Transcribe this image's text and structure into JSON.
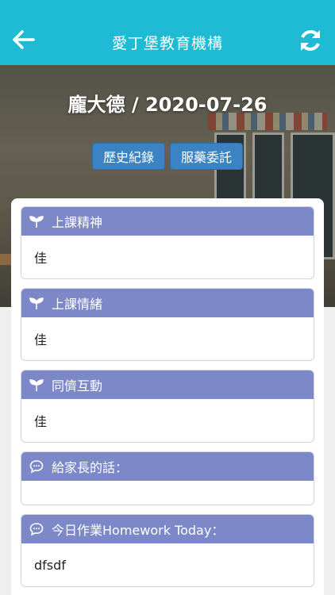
{
  "header": {
    "title": "愛丁堡教育機構",
    "back_icon": "arrow-left-icon",
    "refresh_icon": "refresh-icon"
  },
  "hero": {
    "heading": "龐大德 / 2020-07-26"
  },
  "actions": {
    "history_label": "歷史紀錄",
    "medication_label": "服藥委託"
  },
  "cards": [
    {
      "title": "上課精神",
      "icon": "seedling-icon",
      "value": "佳"
    },
    {
      "title": "上課情緒",
      "icon": "seedling-icon",
      "value": "佳"
    },
    {
      "title": "同儕互動",
      "icon": "seedling-icon",
      "value": "佳"
    },
    {
      "title": "給家長的話：",
      "icon": "comment-icon",
      "value": ""
    },
    {
      "title": "今日作業Homework Today：",
      "icon": "comment-icon",
      "value": "dfsdf"
    }
  ],
  "colors": {
    "topbar": "#1fbad3",
    "card_header": "#7d88c8",
    "button": "#3b83c3"
  }
}
